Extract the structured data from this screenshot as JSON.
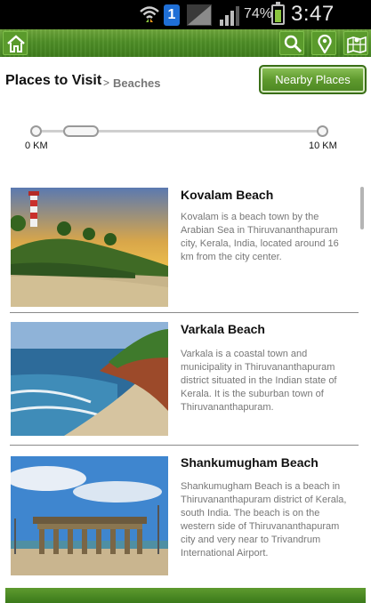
{
  "status_bar": {
    "battery_percent": "74%",
    "time": "3:47 PM",
    "network_badge": "1",
    "icons": [
      "wifi-icon",
      "network-badge-icon",
      "signal-icon",
      "signal-icon",
      "battery-icon"
    ]
  },
  "action_bar": {
    "icons": [
      "home-icon",
      "search-icon",
      "location-pin-icon",
      "map-icon"
    ],
    "accent_color": "#4f8f27"
  },
  "header": {
    "title": "Places to Visit",
    "breadcrumb_separator": ">",
    "breadcrumb": "Beaches",
    "nearby_button": "Nearby Places"
  },
  "distance_slider": {
    "min_label": "0 KM",
    "max_label": "10 KM"
  },
  "places": [
    {
      "name": "Kovalam Beach",
      "description": "Kovalam is a beach town by the Arabian Sea in Thiruvananthapuram city, Kerala, India, located around 16 km from the city center."
    },
    {
      "name": "Varkala Beach",
      "description": "Varkala is a coastal town and municipality in Thiruvananthapuram district situated in the Indian state of Kerala. It is the suburban town of Thiruvananthapuram."
    },
    {
      "name": "Shankumugham Beach",
      "description": "Shankumugham Beach is a beach in Thiruvananthapuram district of Kerala, south India. The beach is on the western side of Thiruvananthapuram city and very near to Trivandrum International Airport."
    }
  ]
}
